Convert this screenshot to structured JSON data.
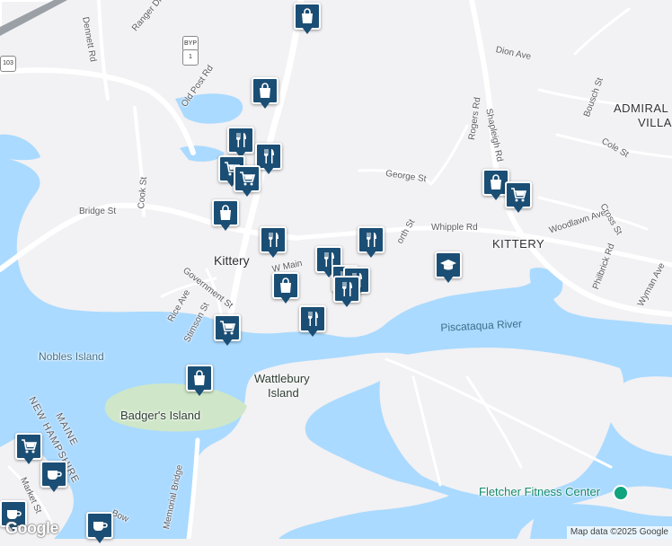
{
  "map": {
    "place_labels": {
      "kittery_center": "Kittery",
      "kittery_east": "KITTERY",
      "admiralty_line1": "ADMIRAL",
      "admiralty_line2": "VILLAG",
      "badgers_island": "Badger's Island",
      "wattlebury_line1": "Wattlebury",
      "wattlebury_line2": "Island",
      "nobles_island": "Nobles Island",
      "maine": "MAINE",
      "new_hampshire": "NEW HAMPSHIRE"
    },
    "water_labels": {
      "piscataqua": "Piscataqua River"
    },
    "road_labels": {
      "dennett": "Dennett Rd",
      "ranger": "Ranger Dr",
      "old_post": "Old Post Rd",
      "cook": "Cook St",
      "bridge": "Bridge St",
      "george": "George St",
      "whipple": "Whipple Rd",
      "rogers": "Rogers Rd",
      "shapleigh": "Shapleigh Rd",
      "dion": "Dion Ave",
      "bousch": "Bousch St",
      "cole": "Cole St",
      "woodlawn": "Woodlawn Ave",
      "cross": "Cross St",
      "philbrick": "Philbrick Rd",
      "wyman": "Wyman Ave",
      "government": "Government St",
      "rice": "Rice Ave",
      "stimson": "Stimson St",
      "wallingford": "W Main",
      "wentworth": "orth St",
      "memorial_bridge": "Memorial Bridge",
      "market": "Market St",
      "bow": "Bow"
    },
    "shields": {
      "byp": "BYP",
      "route1": "1",
      "route103": "103"
    },
    "poi": {
      "fletcher": "Fletcher Fitness Center"
    },
    "google_logo": "Google",
    "attribution": "Map data ©2025 Google",
    "colors": {
      "water": "#aadaff",
      "land": "#f2f1f3",
      "island": "#cce8c4",
      "road": "#ffffff",
      "pin": "#1b4e74"
    }
  },
  "markers": [
    {
      "name": "shopping-marker",
      "icon": "shopping-bag-icon"
    },
    {
      "name": "shopping-marker",
      "icon": "shopping-bag-icon"
    },
    {
      "name": "restaurant-marker",
      "icon": "fork-knife-icon"
    },
    {
      "name": "restaurant-marker",
      "icon": "fork-knife-icon"
    },
    {
      "name": "grocery-marker",
      "icon": "shopping-cart-icon"
    },
    {
      "name": "grocery-marker",
      "icon": "shopping-cart-icon"
    },
    {
      "name": "shopping-marker",
      "icon": "shopping-bag-icon"
    },
    {
      "name": "restaurant-marker",
      "icon": "fork-knife-icon"
    },
    {
      "name": "restaurant-marker",
      "icon": "fork-knife-icon"
    },
    {
      "name": "restaurant-marker",
      "icon": "fork-knife-icon"
    },
    {
      "name": "shopping-marker",
      "icon": "shopping-bag-icon"
    },
    {
      "name": "restaurant-marker",
      "icon": "fork-knife-icon"
    },
    {
      "name": "restaurant-marker",
      "icon": "fork-knife-icon"
    },
    {
      "name": "restaurant-marker",
      "icon": "fork-knife-icon"
    },
    {
      "name": "grocery-marker",
      "icon": "shopping-cart-icon"
    },
    {
      "name": "shopping-marker",
      "icon": "shopping-bag-icon"
    },
    {
      "name": "restaurant-marker",
      "icon": "fork-knife-icon"
    },
    {
      "name": "shopping-marker",
      "icon": "shopping-bag-icon"
    },
    {
      "name": "grocery-marker",
      "icon": "shopping-cart-icon"
    },
    {
      "name": "school-marker",
      "icon": "graduation-cap-icon"
    },
    {
      "name": "grocery-marker",
      "icon": "shopping-cart-icon"
    },
    {
      "name": "cafe-marker",
      "icon": "coffee-cup-icon"
    },
    {
      "name": "cafe-marker",
      "icon": "coffee-cup-icon"
    },
    {
      "name": "cafe-marker",
      "icon": "coffee-cup-icon"
    }
  ]
}
